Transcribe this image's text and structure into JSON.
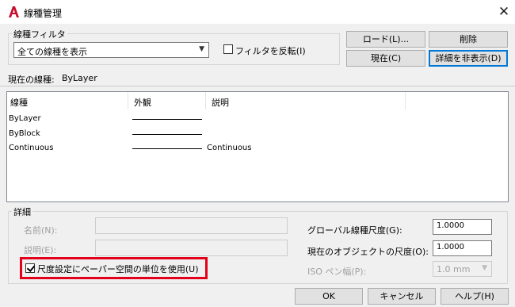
{
  "window": {
    "title": "線種管理",
    "close_glyph": "✕"
  },
  "filter": {
    "group_label": "線種フィルタ",
    "selected": "全ての線種を表示",
    "invert_label": "フィルタを反転(I)"
  },
  "buttons": {
    "load": "ロード(L)...",
    "delete": "削除",
    "current": "現在(C)",
    "hide_details": "詳細を非表示(D)",
    "ok": "OK",
    "cancel": "キャンセル",
    "help": "ヘルプ(H)"
  },
  "current_linetype": {
    "label": "現在の線種:",
    "value": "ByLayer"
  },
  "list": {
    "columns": [
      "線種",
      "外観",
      "説明"
    ],
    "rows": [
      {
        "name": "ByLayer",
        "description": ""
      },
      {
        "name": "ByBlock",
        "description": ""
      },
      {
        "name": "Continuous",
        "description": "Continuous"
      }
    ]
  },
  "details": {
    "group_label": "詳細",
    "name_label": "名前(N):",
    "desc_label": "説明(E):",
    "paper_space_label": "尺度設定にペーパー空間の単位を使用(U)",
    "global_scale_label": "グローバル線種尺度(G):",
    "global_scale_value": "1.0000",
    "current_scale_label": "現在のオブジェクトの尺度(O):",
    "current_scale_value": "1.0000",
    "iso_pen_label": "ISO ペン幅(P):",
    "iso_pen_value": "1.0 mm"
  },
  "colors": {
    "highlight": "#e3001b",
    "app_icon": "#c8102e"
  }
}
